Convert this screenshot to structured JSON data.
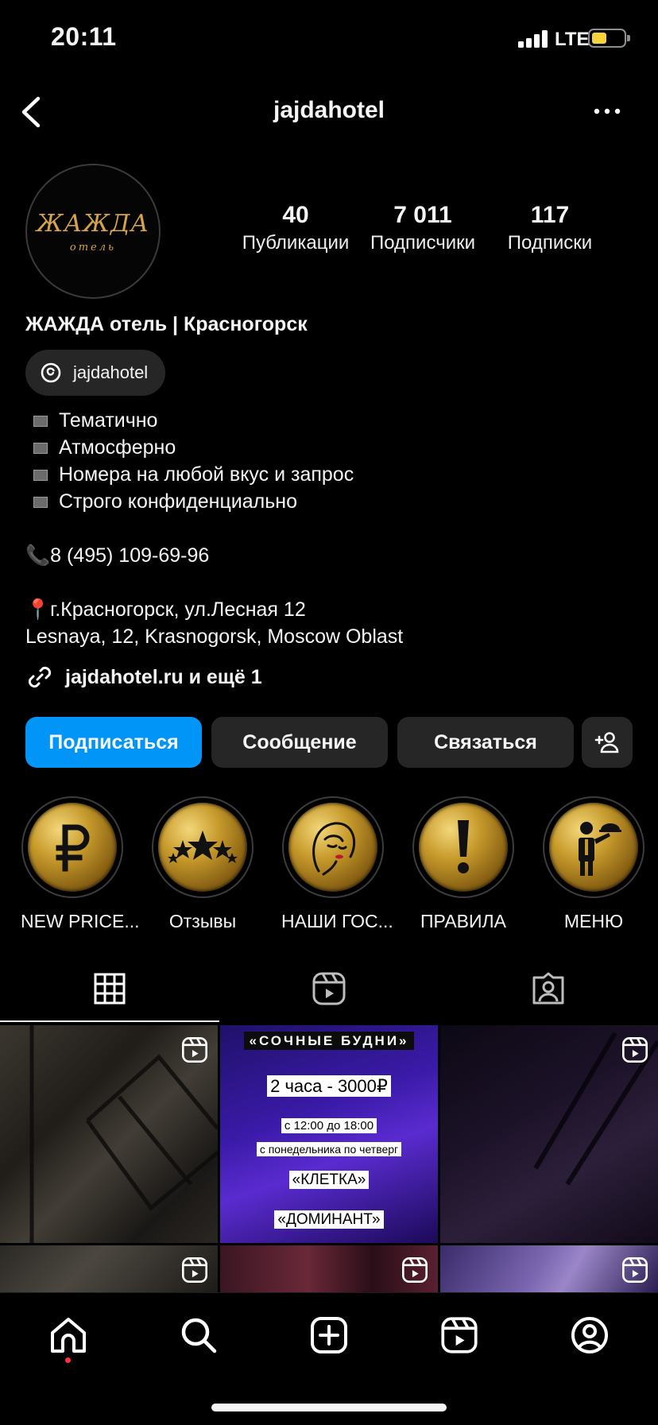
{
  "status_bar": {
    "time": "20:11",
    "network": "LTE"
  },
  "header": {
    "username": "jajdahotel"
  },
  "profile": {
    "avatar_wordmark": "ЖАЖДА",
    "avatar_sub": "отель",
    "stats": [
      {
        "number": "40",
        "label": "Публикации"
      },
      {
        "number": "7 011",
        "label": "Подписчики"
      },
      {
        "number": "117",
        "label": "Подписки"
      }
    ],
    "name": "ЖАЖДА отель | Красногорск",
    "threads_handle": "jajdahotel",
    "bio_lines": [
      "Тематично",
      "Атмосферно",
      "Номера на любой вкус и запрос",
      "Строго конфиденциально"
    ],
    "phone": "📞8 (495) 109-69-96",
    "address_line1": "📍г.Красногорск, ул.Лесная 12",
    "address_line2": "Lesnaya, 12, Krasnogorsk, Moscow Oblast",
    "link": "jajdahotel.ru и ещё 1"
  },
  "actions": {
    "follow": "Подписаться",
    "message": "Сообщение",
    "contact": "Связаться"
  },
  "highlights": [
    {
      "label": "NEW PRICE...",
      "icon": "ruble-icon"
    },
    {
      "label": "Отзывы",
      "icon": "stars-icon"
    },
    {
      "label": "НАШИ ГОС...",
      "icon": "woman-face-icon"
    },
    {
      "label": "ПРАВИЛА",
      "icon": "exclamation-icon"
    },
    {
      "label": "МЕНЮ",
      "icon": "waiter-icon"
    }
  ],
  "promo_post": {
    "title": "«СОЧНЫЕ БУДНИ»",
    "price": "2 часа - 3000₽",
    "time": "с 12:00 до 18:00",
    "days": "с понедельника по четверг",
    "room1": "«КЛЕТКА»",
    "room2": "«ДОМИНАНТ»"
  },
  "colors": {
    "background": "#000000",
    "primary_button": "#0095f6",
    "secondary_button": "#262626",
    "accent_gold": "#d6a34a",
    "notification_dot": "#ff3040"
  }
}
